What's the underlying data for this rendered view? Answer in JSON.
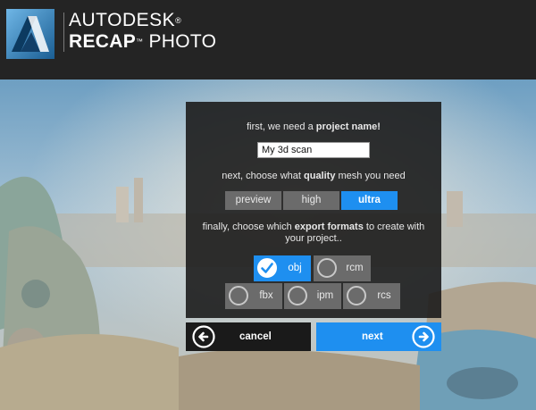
{
  "header": {
    "brand_company": "AUTODESK",
    "brand_company_mark": "®",
    "brand_product": "RECAP",
    "brand_product_mark": "™",
    "brand_product_suffix": "PHOTO",
    "logo_icon": "autodesk-logo-icon"
  },
  "dialog": {
    "name_prompt_pre": "first, we need a ",
    "name_prompt_bold": "project name!",
    "project_name_value": "My 3d scan",
    "quality_prompt_pre": "next, choose what ",
    "quality_prompt_bold": "quality",
    "quality_prompt_post": " mesh you need",
    "quality_options": [
      "preview",
      "high",
      "ultra"
    ],
    "quality_selected": "ultra",
    "export_prompt_pre": "finally, choose which ",
    "export_prompt_bold": "export formats",
    "export_prompt_post": " to create with",
    "export_prompt_line2": "your project..",
    "formats": [
      {
        "label": "obj",
        "checked": true
      },
      {
        "label": "rcm",
        "checked": false
      },
      {
        "label": "fbx",
        "checked": false
      },
      {
        "label": "ipm",
        "checked": false
      },
      {
        "label": "rcs",
        "checked": false
      }
    ]
  },
  "actions": {
    "cancel_label": "cancel",
    "next_label": "next",
    "cancel_icon": "arrow-left-circle-icon",
    "next_icon": "arrow-right-circle-icon"
  },
  "colors": {
    "header_bg": "#242424",
    "accent": "#1e8ff0",
    "dialog_bg": "#1c1c1c",
    "inactive_button": "#6b6b6b"
  }
}
